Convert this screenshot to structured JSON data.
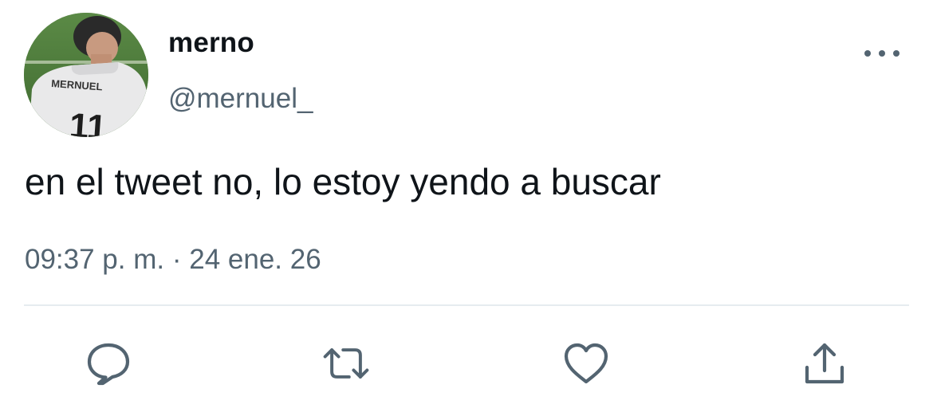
{
  "user": {
    "display_name": "merno",
    "handle": "@mernuel_",
    "avatar_jersey_name": "MERNUEL",
    "avatar_jersey_number": "11"
  },
  "tweet": {
    "text": "en el tweet no, lo estoy yendo a buscar",
    "time": "09:37 p. m.",
    "separator": "·",
    "date": "24 ene. 26"
  },
  "icons": {
    "more": "more-horizontal-icon",
    "reply": "reply-icon",
    "retweet": "retweet-icon",
    "like": "heart-icon",
    "share": "share-icon"
  },
  "colors": {
    "text_primary": "#0f1419",
    "text_secondary": "#536471",
    "divider": "#e6ecf0",
    "icon": "#536471"
  }
}
